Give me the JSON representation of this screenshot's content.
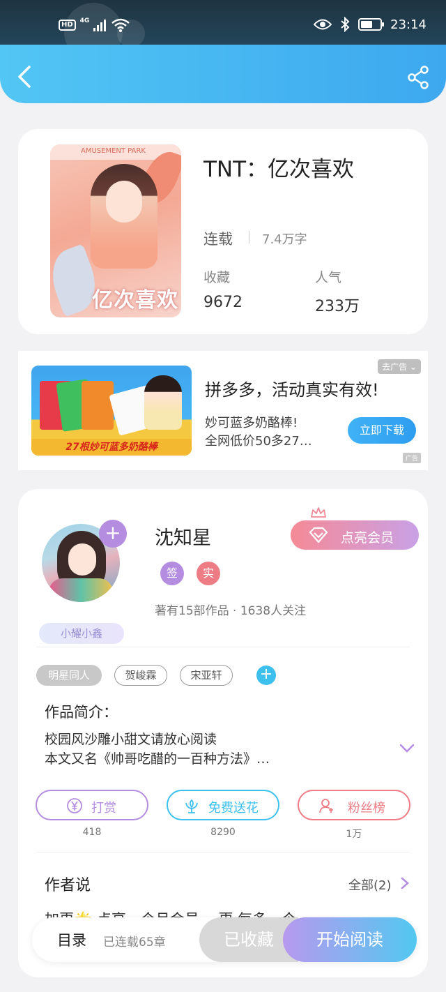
{
  "status_bar": {
    "time": "23:14",
    "hd": "HD",
    "network": "4G"
  },
  "book": {
    "title": "TNT：亿次喜欢",
    "cover_title": "亿次喜欢",
    "cover_top": "AMUSEMENT PARK",
    "status": "连载",
    "word_count": "7.4万字",
    "collect_label": "收藏",
    "collect_value": "9672",
    "popularity_label": "人气",
    "popularity_value": "233万"
  },
  "ad": {
    "close_label": "去广告",
    "title": "拼多多，活动真实有效!",
    "desc": "妙可蓝多奶酪棒!\n全网低价50多27…",
    "cta": "立即下载",
    "image_text": "27根妙可蓝多奶酪棒",
    "mark": "广告"
  },
  "author": {
    "name": "沈知星",
    "vip_label": "点亮会员",
    "tag_sign": "签",
    "tag_real": "实",
    "meta": "著有15部作品 · 1638人关注",
    "fan_badge": "小耀小鑫",
    "follow_icon": "+"
  },
  "tags": [
    "明星同人",
    "贺峻霖",
    "宋亚轩"
  ],
  "tag_add": "+",
  "intro": {
    "label": "作品简介：",
    "line1": "校园风沙雕小甜文请放心阅读",
    "line2": "本文又名《帅哥吃醋的一百种方法》…"
  },
  "actions": [
    {
      "label": "打赏",
      "count": "418",
      "color": "#b48de0"
    },
    {
      "label": "免费送花",
      "count": "8290",
      "color": "#3ec0ee"
    },
    {
      "label": "粉丝榜",
      "count": "1万",
      "color": "#ee7c84"
    }
  ],
  "author_says": {
    "label": "作者说",
    "view_all": "全部(2)"
  },
  "peek_text": "加更🌟 点亮一个月会员 一更 每多一个",
  "bottom_bar": {
    "toc": "目录",
    "toc_sub": "已连载65章",
    "collected": "已收藏",
    "read": "开始阅读"
  },
  "colors": {
    "header_start": "#52c6f4",
    "header_end": "#3da8ef",
    "vip_start": "#f58a96",
    "vip_end": "#c9a1e6",
    "tag_sign": "#b48de0",
    "tag_real": "#ee7c84"
  }
}
